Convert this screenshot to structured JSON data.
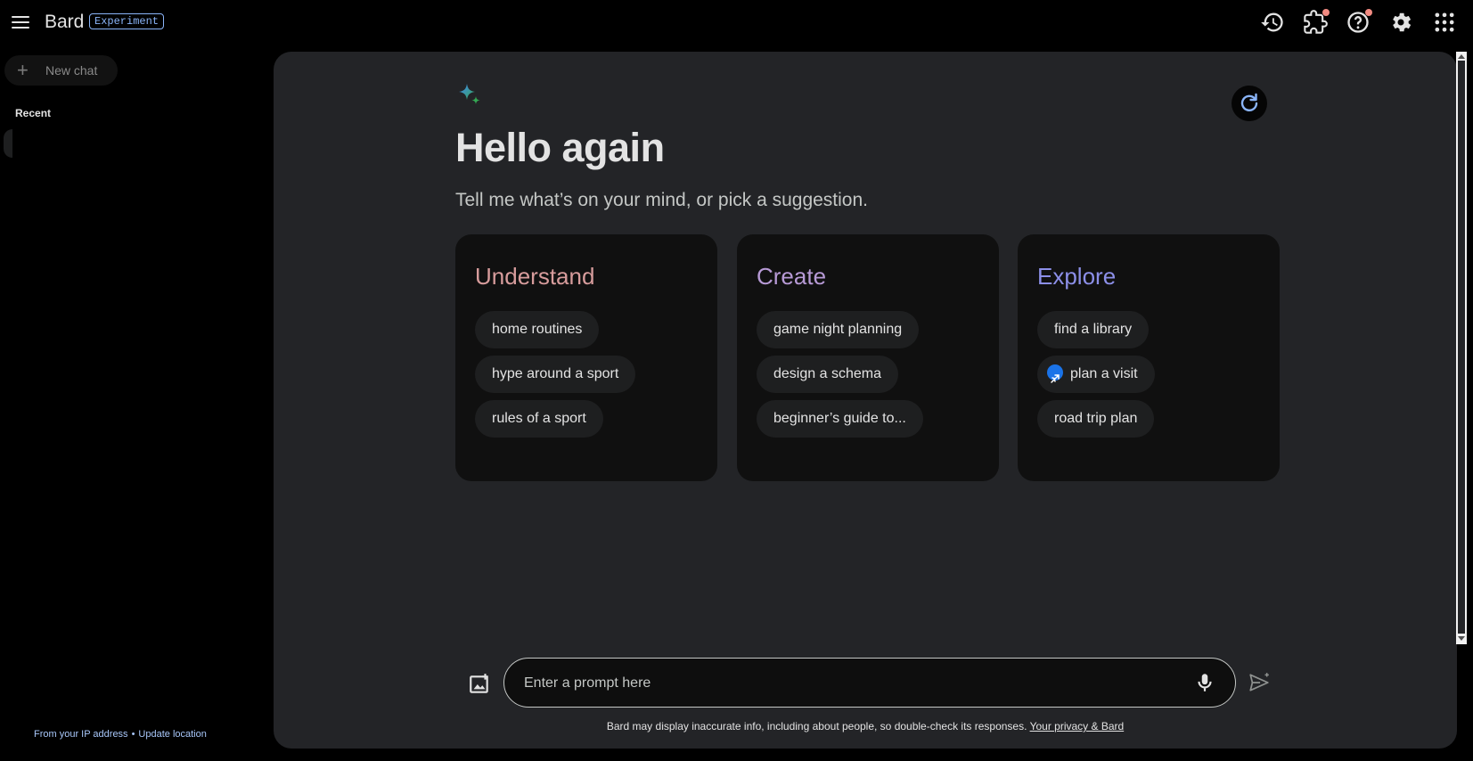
{
  "header": {
    "brand": "Bard",
    "badge": "Experiment",
    "icons": [
      "menu-icon",
      "history-icon",
      "extensions-icon",
      "help-icon",
      "settings-icon",
      "apps-grid-icon"
    ],
    "notification_color": "#f28b82"
  },
  "sidebar": {
    "new_chat_label": "New chat",
    "recent_label": "Recent",
    "location_source": "From your IP address",
    "location_separator": "•",
    "update_location_label": "Update location"
  },
  "main": {
    "greeting": "Hello again",
    "subtitle": "Tell me what’s on your mind, or pick a suggestion.",
    "cards": [
      {
        "title": "Understand",
        "color": "#d79c9c",
        "chips": [
          "home routines",
          "hype around a sport",
          "rules of a sport"
        ]
      },
      {
        "title": "Create",
        "color": "#b79ad6",
        "chips": [
          "game night planning",
          "design a schema",
          "beginner’s guide to..."
        ]
      },
      {
        "title": "Explore",
        "color": "#8c8fe8",
        "chips": [
          "find a library",
          "plan a visit",
          "road trip plan"
        ]
      }
    ],
    "prompt_placeholder": "Enter a prompt here",
    "disclaimer": "Bard may display inaccurate info, including about people, so double-check its responses.",
    "privacy_link": "Your privacy & Bard"
  }
}
